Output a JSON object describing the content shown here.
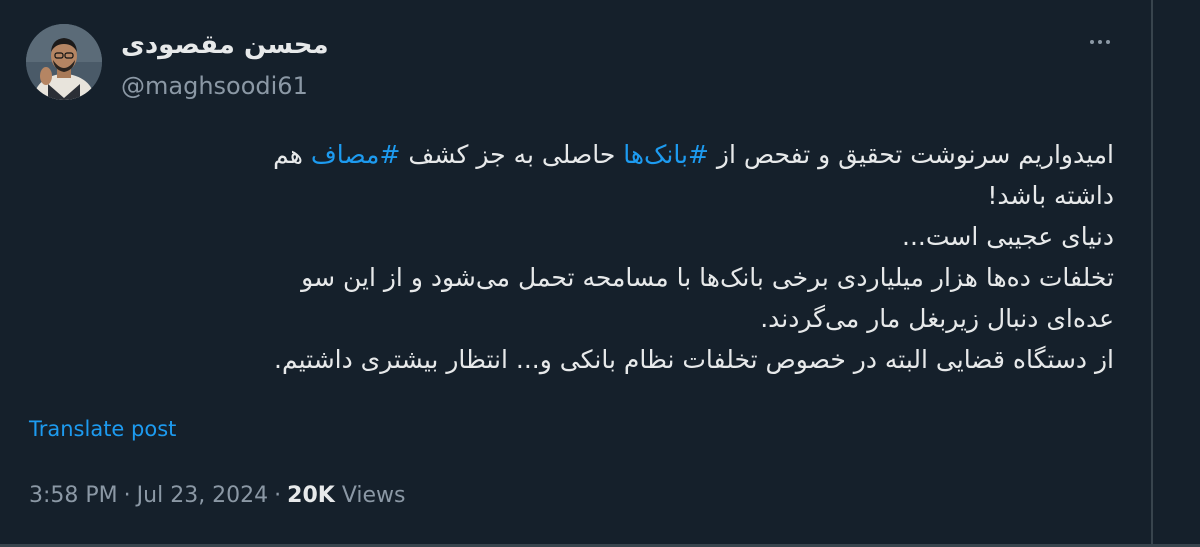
{
  "author": {
    "display_name": "محسن مقصودی",
    "handle": "@maghsoodi61"
  },
  "tweet": {
    "line1": {
      "part1": "امیدواریم سرنوشت تحقیق و تفحص از ",
      "hashtag1": "#بانک‌ها",
      "part2": " حاصلی به جز کشف ",
      "hashtag2": "#مصاف",
      "part3": " هم"
    },
    "line2": "داشته باشد!",
    "line3": "دنیای عجیبی است...",
    "line4": "تخلفات ده‌ها هزار میلیاردی برخی بانک‌ها با مسامحه تحمل می‌شود و از این سو",
    "line5": "عده‌ای دنبال زیربغل مار می‌گردند.",
    "line6": "از دستگاه قضایی البته در خصوص تخلفات نظام بانکی و... انتظار بیشتری داشتیم."
  },
  "translate_label": "Translate post",
  "meta": {
    "time": "3:58 PM",
    "separator": "·",
    "date": "Jul 23, 2024",
    "views_count": "20K",
    "views_label": "Views"
  },
  "icons": {
    "more": "more-horizontal-icon"
  },
  "colors": {
    "background": "#15202b",
    "text": "#e7e9ea",
    "secondary": "#8b98a5",
    "accent": "#1d9bf0",
    "border": "#38444d"
  }
}
